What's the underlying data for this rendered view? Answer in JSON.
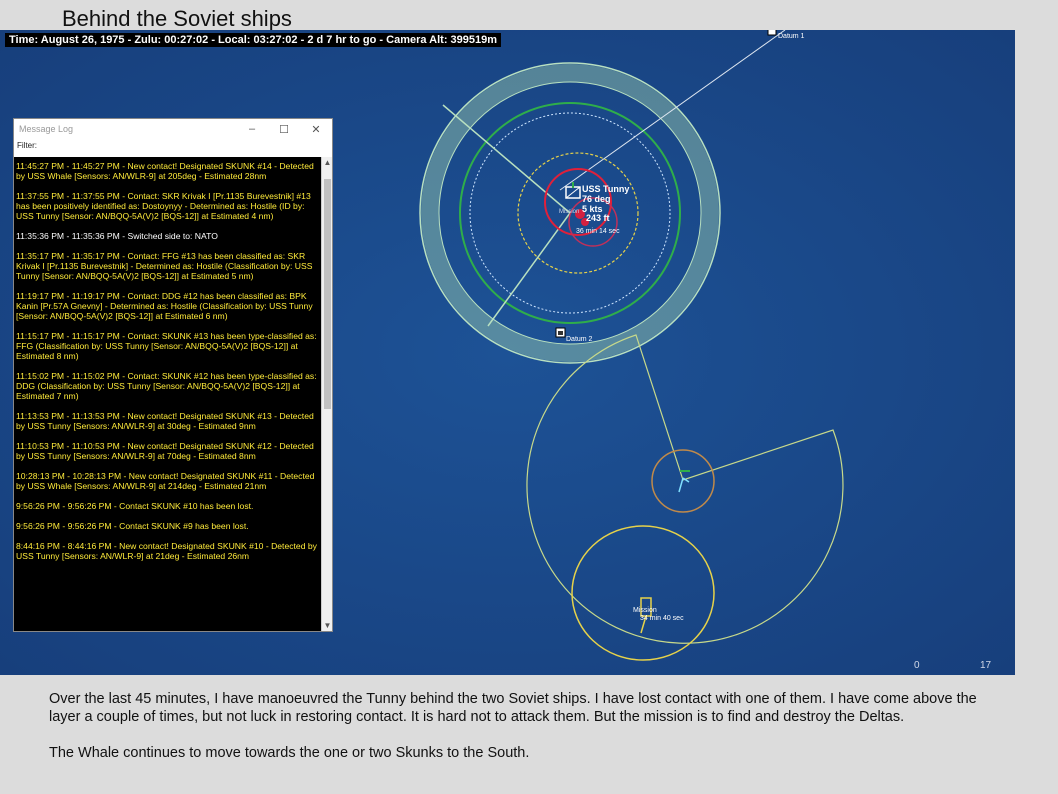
{
  "page_title": "Behind the Soviet ships",
  "status_bar": "Time: August 26, 1975 - Zulu: 00:27:02 - Local: 03:27:02 - 2 d 7 hr to go -  Camera Alt: 399519m",
  "map": {
    "datum1": "Datum 1",
    "datum2": "Datum 2",
    "unit_name": "USS Tunny",
    "unit_heading": "76 deg",
    "unit_speed": "5 kts",
    "unit_depth": "243 ft",
    "unit_eta": "36 min 14 sec",
    "unit_mission": "Mission",
    "other_mission": "Mission",
    "other_eta": "34 min 40 sec",
    "corner_left": "0",
    "corner_right": "17",
    "colors": {
      "ocean": "#1a4d8f",
      "range_ring": "#8fc89a",
      "contact": "#e0203a",
      "track": "#f0e060"
    }
  },
  "message_log": {
    "title": "Message Log",
    "filter_label": "Filter:",
    "entries": [
      "11:45:27 PM - 11:45:27 PM - New contact! Designated SKUNK #14 - Detected by USS Whale [Sensors: AN/WLR-9] at 205deg - Estimated 28nm",
      "11:37:55 PM - 11:37:55 PM - Contact: SKR Krivak I [Pr.1135 Burevestnik] #13 has been positively identified as: Dostoynyy - Determined as: Hostile (ID by: USS Tunny [Sensor: AN/BQQ-5A(V)2 [BQS-12]] at Estimated 4 nm)",
      "11:35:36 PM - 11:35:36 PM - Switched side to: NATO",
      "11:35:17 PM - 11:35:17 PM - Contact: FFG #13 has been classified as: SKR Krivak I [Pr.1135 Burevestnik] - Determined as: Hostile (Classification by: USS Tunny [Sensor: AN/BQQ-5A(V)2 [BQS-12]] at Estimated 5 nm)",
      "11:19:17 PM - 11:19:17 PM - Contact: DDG #12 has been classified as: BPK Kanin [Pr.57A Gnevny] - Determined as: Hostile (Classification by: USS Tunny [Sensor: AN/BQQ-5A(V)2 [BQS-12]] at Estimated 6 nm)",
      "11:15:17 PM - 11:15:17 PM - Contact: SKUNK #13 has been type-classified as: FFG (Classification by: USS Tunny [Sensor: AN/BQQ-5A(V)2 [BQS-12]] at Estimated 8 nm)",
      "11:15:02 PM - 11:15:02 PM - Contact: SKUNK #12 has been type-classified as: DDG (Classification by: USS Tunny [Sensor: AN/BQQ-5A(V)2 [BQS-12]] at Estimated 7 nm)",
      "11:13:53 PM - 11:13:53 PM - New contact! Designated SKUNK #13 - Detected by USS Tunny [Sensors: AN/WLR-9] at 30deg - Estimated 9nm",
      "11:10:53 PM - 11:10:53 PM - New contact! Designated SKUNK #12 - Detected by USS Tunny [Sensors: AN/WLR-9] at 70deg - Estimated 8nm",
      "10:28:13 PM - 10:28:13 PM - New contact! Designated SKUNK #11 - Detected by USS Whale [Sensors: AN/WLR-9] at 214deg - Estimated 21nm",
      "9:56:26 PM - 9:56:26 PM - Contact SKUNK #10 has been lost.",
      "9:56:26 PM - 9:56:26 PM - Contact SKUNK #9 has been lost.",
      "8:44:16 PM - 8:44:16 PM - New contact! Designated SKUNK #10 - Detected by USS Tunny [Sensors: AN/WLR-9] at 21deg - Estimated 26nm"
    ]
  },
  "caption": {
    "p1": "Over the last 45 minutes, I have manoeuvred the Tunny behind the two Soviet ships.  I have lost contact with one of them.  I have come above the layer a couple of times, but not luck in restoring contact. It is hard not to attack them.  But the mission is to find and destroy the Deltas.",
    "p2": "The Whale continues to move towards the one or two Skunks to the South."
  }
}
